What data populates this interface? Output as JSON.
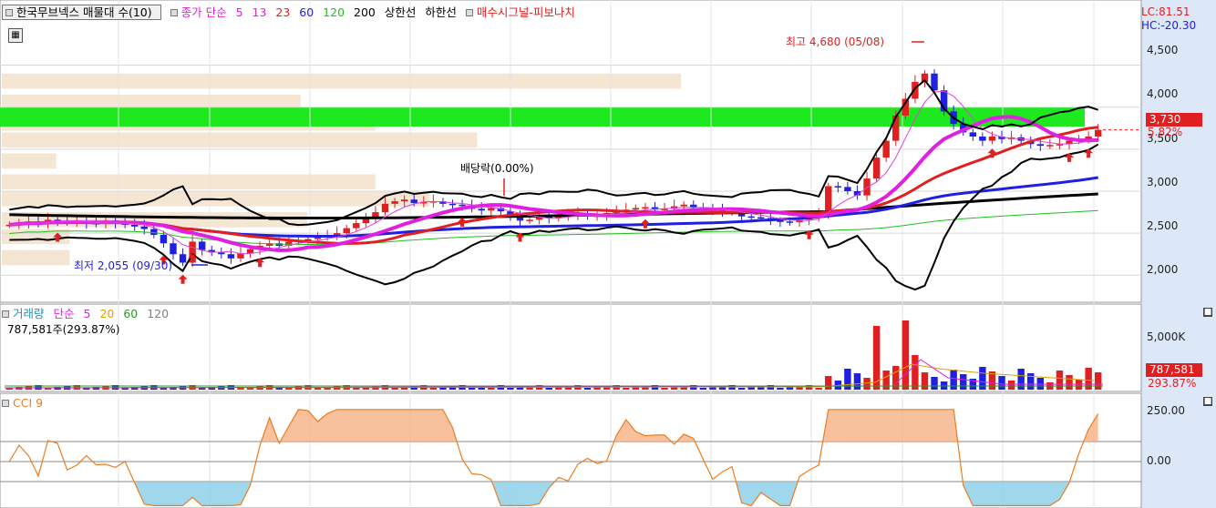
{
  "panels": {
    "price": {
      "title_box": "한국무브넥스 매물대 수(10)",
      "ma_legend": {
        "prefix": "종가 단순",
        "periods": [
          "5",
          "13",
          "23",
          "60",
          "120",
          "200"
        ],
        "colors": [
          "#e020e0",
          "#e020e0",
          "#e02020",
          "#2020e0",
          "#20c020",
          "#000000"
        ]
      },
      "limit_labels": [
        "상한선",
        "하한선"
      ],
      "signal_label": "매수시그널-피보나치",
      "lc": "LC:81.51",
      "hc": "HC:-20.30"
    },
    "volume": {
      "legend_title": "거래량",
      "legend_prefix": "단순",
      "periods": [
        "5",
        "20",
        "60",
        "120"
      ],
      "period_colors": [
        "#e020e0",
        "#e0a000",
        "#20a020",
        "#808080"
      ],
      "value_line": "787,581주(293.87%)"
    },
    "cci": {
      "legend": "CCI 9"
    }
  },
  "annotations": {
    "high": "최고 4,680 (05/08)",
    "low": "최저 2,055 (09/30)",
    "dividend": "배당락(0.00%)"
  },
  "axis": {
    "price_ticks": [
      "4,500",
      "4,000",
      "3,500",
      "3,000",
      "2,500",
      "2,000"
    ],
    "volume_ticks": [
      "5,000K"
    ],
    "cci_ticks": [
      "250.00",
      "0.00"
    ],
    "current_price_tag": "3,730",
    "current_change_tag": "5.82%",
    "volume_tag": "787,581",
    "volume_pct_tag": "293.87%"
  },
  "colors": {
    "green_band": "#1ee81e",
    "volume_profile": "#f5e6d3",
    "axis_bg": "#dce8f7",
    "tag_red": "#e02020",
    "cci_fill_pos": "#f4b183",
    "cci_fill_neg": "#87cee8",
    "cci_line": "#ec7c20"
  },
  "chart_data": {
    "type": "candlestick",
    "title": "한국무브넥스",
    "y_range": [
      1700,
      4950
    ],
    "close_approx": [
      2600,
      2620,
      2640,
      2610,
      2660,
      2650,
      2630,
      2640,
      2620,
      2610,
      2650,
      2620,
      2600,
      2580,
      2550,
      2480,
      2380,
      2250,
      2150,
      2400,
      2300,
      2270,
      2250,
      2200,
      2260,
      2310,
      2350,
      2380,
      2350,
      2400,
      2420,
      2430,
      2450,
      2470,
      2500,
      2560,
      2620,
      2680,
      2750,
      2850,
      2880,
      2900,
      2860,
      2870,
      2880,
      2850,
      2840,
      2830,
      2790,
      2770,
      2800,
      2760,
      2700,
      2650,
      2660,
      2700,
      2680,
      2700,
      2720,
      2730,
      2700,
      2710,
      2740,
      2760,
      2780,
      2800,
      2810,
      2780,
      2790,
      2820,
      2840,
      2800,
      2780,
      2770,
      2760,
      2750,
      2700,
      2690,
      2680,
      2650,
      2640,
      2630,
      2660,
      2680,
      2720,
      3060,
      3050,
      3000,
      2950,
      3150,
      3400,
      3600,
      3900,
      4100,
      4300,
      4400,
      4200,
      3950,
      3800,
      3700,
      3650,
      3600,
      3650,
      3620,
      3640,
      3600,
      3560,
      3540,
      3550,
      3560,
      3600,
      3620,
      3650,
      3730
    ],
    "volume_profile": [
      {
        "price_from": 4200,
        "price_to": 4400,
        "relative": 1.0
      },
      {
        "price_from": 3950,
        "price_to": 4150,
        "relative": 0.44
      },
      {
        "price_from": 3700,
        "price_to": 3900,
        "relative": 0.55
      },
      {
        "price_from": 3500,
        "price_to": 3700,
        "relative": 0.7
      },
      {
        "price_from": 3250,
        "price_to": 3450,
        "relative": 0.08
      },
      {
        "price_from": 3000,
        "price_to": 3200,
        "relative": 0.55
      },
      {
        "price_from": 2800,
        "price_to": 3000,
        "relative": 0.63
      },
      {
        "price_from": 2550,
        "price_to": 2750,
        "relative": 0.45
      },
      {
        "price_from": 2350,
        "price_to": 2550,
        "relative": 0.1
      },
      {
        "price_from": 2100,
        "price_to": 2300,
        "relative": 0.1
      }
    ]
  }
}
